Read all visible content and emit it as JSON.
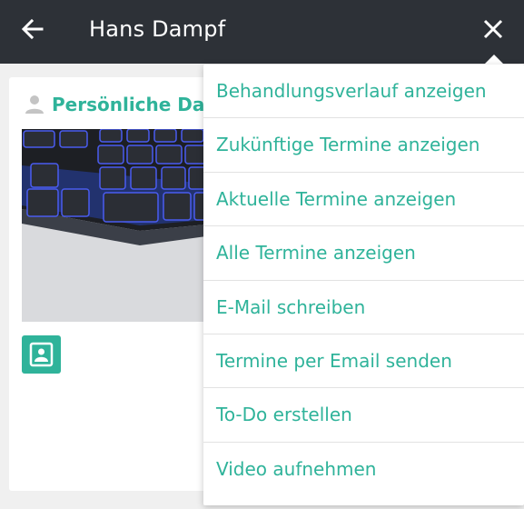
{
  "appbar": {
    "title": "Hans Dampf",
    "back_icon": "arrow-left-icon",
    "close_icon": "close-icon"
  },
  "card": {
    "section_title": "Persönliche Daten",
    "person_icon": "person-icon",
    "contact_icon": "contact-card-icon"
  },
  "menu": {
    "items": [
      {
        "label": "Behandlungsverlauf anzeigen"
      },
      {
        "label": "Zukünftige Termine anzeigen"
      },
      {
        "label": "Aktuelle Termine anzeigen"
      },
      {
        "label": "Alle Termine anzeigen"
      },
      {
        "label": "E-Mail schreiben"
      },
      {
        "label": "Termine per Email senden"
      },
      {
        "label": "To-Do erstellen"
      },
      {
        "label": "Video aufnehmen"
      }
    ]
  },
  "colors": {
    "appbar_bg": "#2d3137",
    "accent": "#2fb39a",
    "background": "#f0f0f0"
  }
}
